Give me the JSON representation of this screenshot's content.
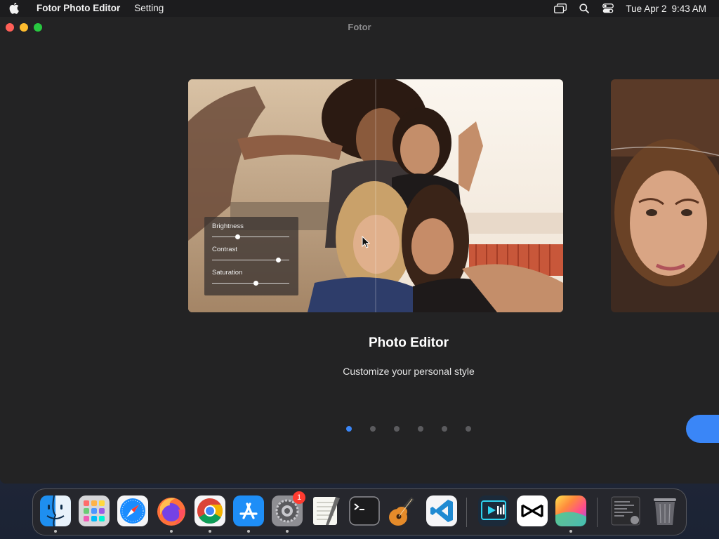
{
  "menubar": {
    "app_name": "Fotor Photo Editor",
    "menu_setting": "Setting",
    "clock_day": "Tue Apr 2",
    "clock_time": "9:43 AM"
  },
  "window": {
    "title": "Fotor"
  },
  "carousel": {
    "adjust_panel": {
      "sliders": [
        {
          "label": "Brightness",
          "value": 0.33
        },
        {
          "label": "Contrast",
          "value": 0.85
        },
        {
          "label": "Saturation",
          "value": 0.56
        }
      ]
    },
    "slide_title": "Photo Editor",
    "slide_subtitle": "Customize your personal style",
    "page_count": 6,
    "active_page": 1
  },
  "dock": {
    "apps": [
      {
        "name": "Finder",
        "icon": "finder-icon",
        "running": true
      },
      {
        "name": "Launchpad",
        "icon": "launchpad-icon",
        "running": false
      },
      {
        "name": "Safari",
        "icon": "safari-icon",
        "running": false
      },
      {
        "name": "Firefox",
        "icon": "firefox-icon",
        "running": true
      },
      {
        "name": "Chrome",
        "icon": "chrome-icon",
        "running": true
      },
      {
        "name": "App Store",
        "icon": "app-store-icon",
        "running": true
      },
      {
        "name": "System Settings",
        "icon": "system-settings-icon",
        "running": true,
        "badge": "1"
      },
      {
        "name": "TextEdit",
        "icon": "textedit-icon",
        "running": false
      },
      {
        "name": "Terminal",
        "icon": "terminal-icon",
        "running": false
      },
      {
        "name": "GarageBand",
        "icon": "garageband-icon",
        "running": false
      },
      {
        "name": "Visual Studio Code",
        "icon": "vscode-icon",
        "running": false
      },
      {
        "name": "Screen Recorder",
        "icon": "screen-recorder-icon",
        "running": false
      },
      {
        "name": "CapCut",
        "icon": "capcut-icon",
        "running": false
      },
      {
        "name": "Fotor Photo Editor",
        "icon": "fotor-icon",
        "running": true
      },
      {
        "name": "Recent Document",
        "icon": "recent-document-icon",
        "running": false
      },
      {
        "name": "Trash",
        "icon": "trash-icon",
        "running": false
      }
    ]
  },
  "colors": {
    "accent": "#3a86f7",
    "window_bg": "#232324",
    "menubar_bg": "#1c1c1e",
    "badge": "#ff3b30"
  }
}
